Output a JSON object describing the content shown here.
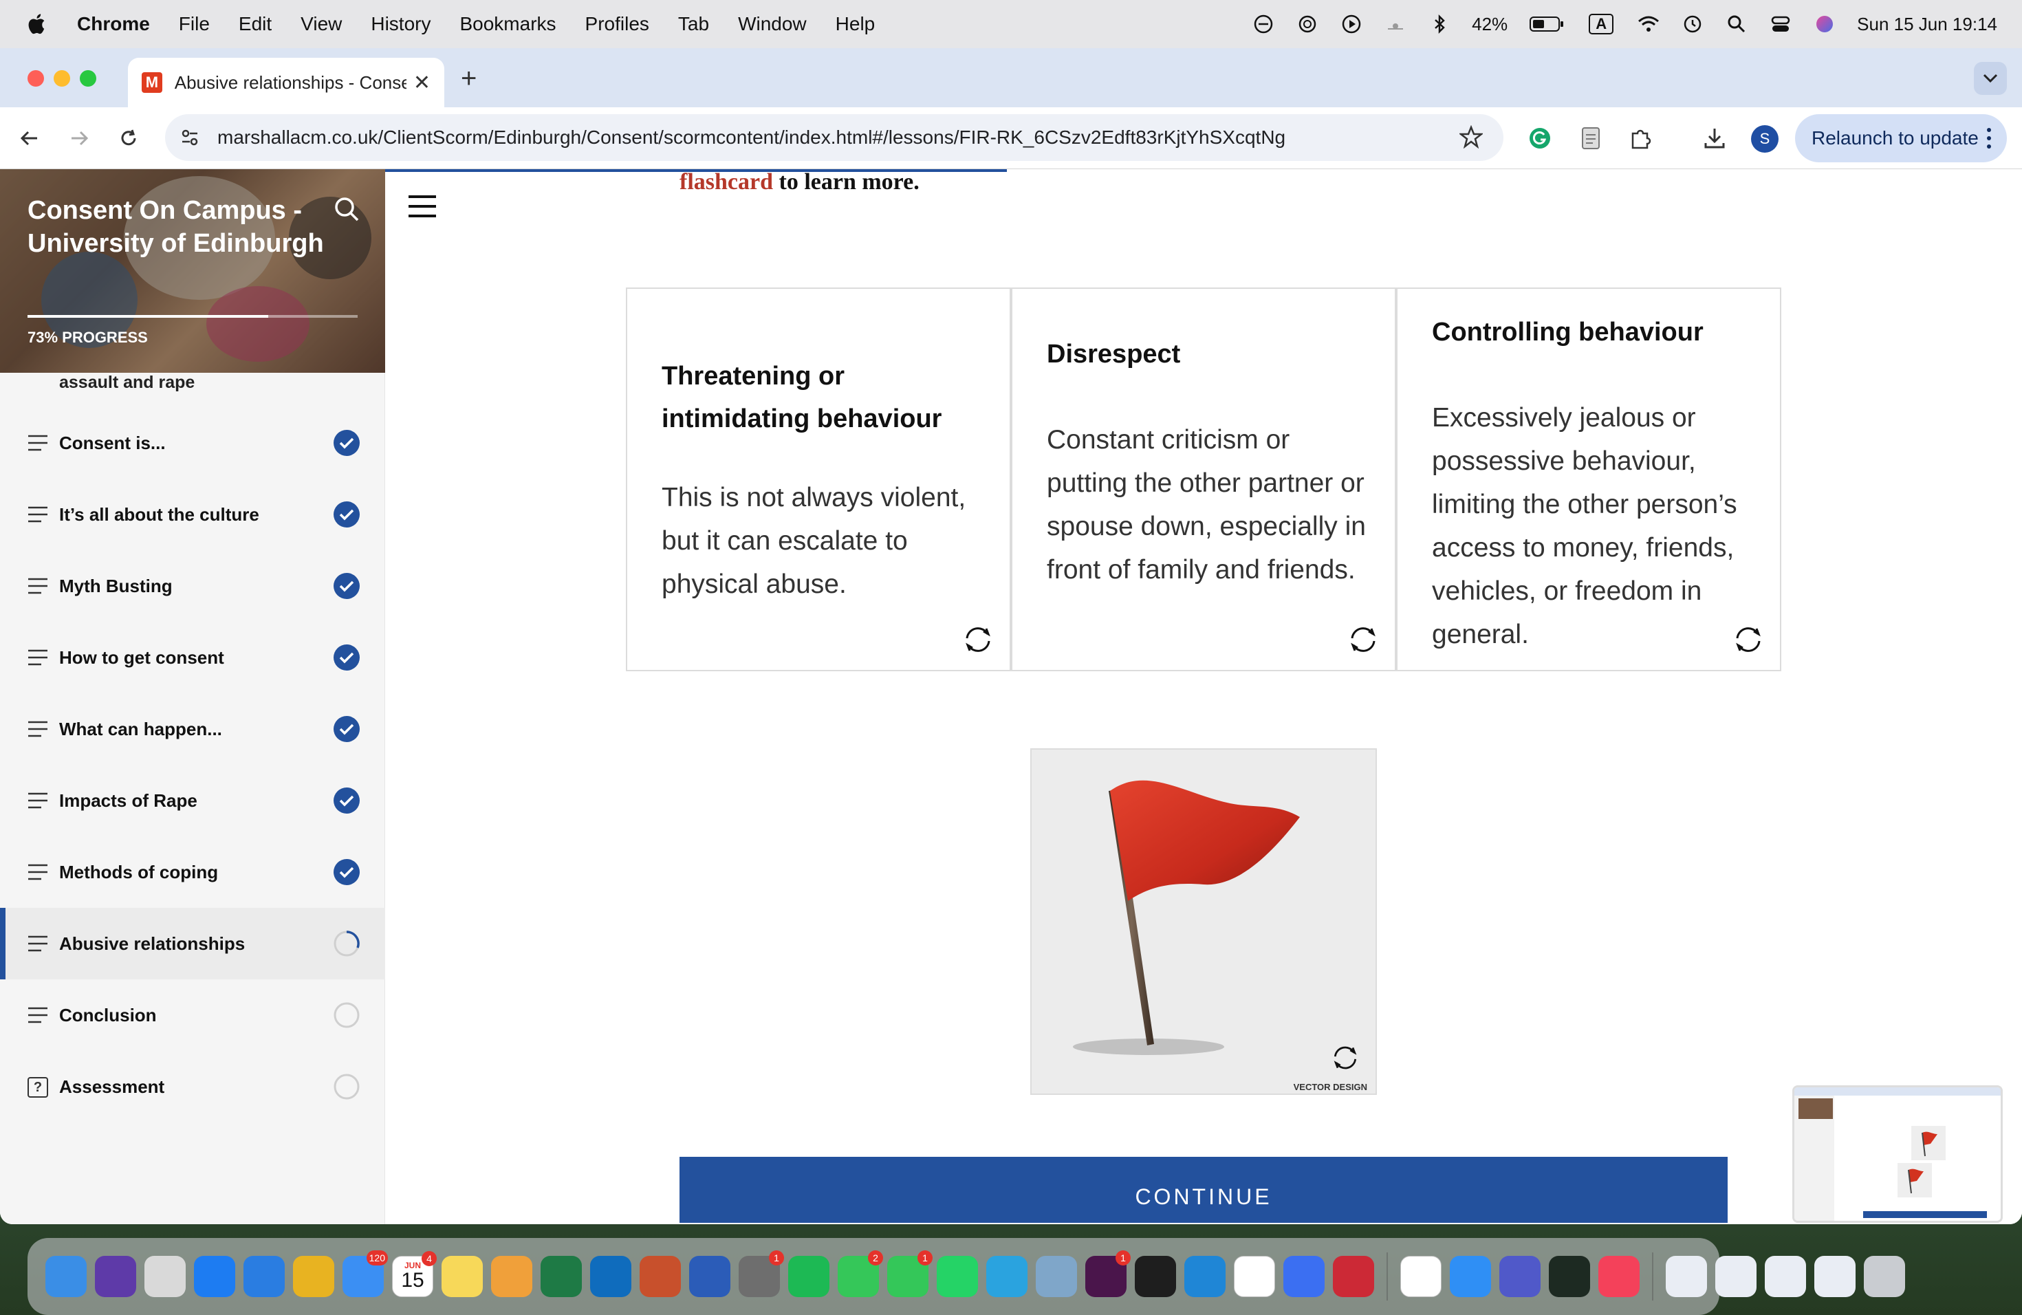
{
  "menubar": {
    "app": "Chrome",
    "items": [
      "File",
      "Edit",
      "View",
      "History",
      "Bookmarks",
      "Profiles",
      "Tab",
      "Window",
      "Help"
    ],
    "battery": "42%",
    "input_source": "A",
    "datetime": "Sun 15 Jun  19:14"
  },
  "browser": {
    "tab_title": "Abusive relationships - Conse",
    "tab_favicon": "M",
    "url": "marshallacm.co.uk/ClientScorm/Edinburgh/Consent/scormcontent/index.html#/lessons/FIR-RK_6CSzv2Edft83rKjtYhSXcqtNg",
    "profile_initial": "S",
    "relaunch_label": "Relaunch to update"
  },
  "sidebar": {
    "course_title": "Consent On Campus - University of Edinburgh",
    "progress_percent": 73,
    "progress_label": "73% PROGRESS",
    "partial_item": "assault and rape",
    "lessons": [
      {
        "label": "Consent is...",
        "status": "complete"
      },
      {
        "label": "It’s all about the culture",
        "status": "complete"
      },
      {
        "label": "Myth Busting",
        "status": "complete"
      },
      {
        "label": "How to get consent",
        "status": "complete"
      },
      {
        "label": "What can happen...",
        "status": "complete"
      },
      {
        "label": "Impacts of Rape",
        "status": "complete"
      },
      {
        "label": "Methods of coping",
        "status": "complete"
      },
      {
        "label": "Abusive relationships",
        "status": "in-progress"
      },
      {
        "label": "Conclusion",
        "status": "not-started"
      },
      {
        "label": "Assessment",
        "status": "not-started"
      }
    ]
  },
  "main": {
    "intro_accent": "flashcard",
    "intro_rest": " to learn more.",
    "cards": [
      {
        "title": "Threatening or intimidating behaviour",
        "body": "This is not always violent, but it can escalate to physical abuse."
      },
      {
        "title": "Disrespect",
        "body": "Constant criticism or putting the other partner or spouse down, especially in front of family and friends."
      },
      {
        "title": "Controlling behaviour",
        "body": "Excessively jealous or possessive behaviour, limiting the other person’s access to money, friends, vehicles, or freedom in general."
      }
    ],
    "image_credit": "VECTOR DESIGN",
    "continue_label": "CONTINUE"
  },
  "dock": {
    "badges": {
      "mail": "120",
      "calendar_month": "JUN",
      "calendar_day": "15",
      "calendar": "4",
      "settings": "1",
      "messages": "2",
      "facetime": "1",
      "slack": "1"
    }
  },
  "colors": {
    "accent_blue": "#23519d",
    "flashcard_red": "#b5382a",
    "check_blue": "#23519d"
  }
}
